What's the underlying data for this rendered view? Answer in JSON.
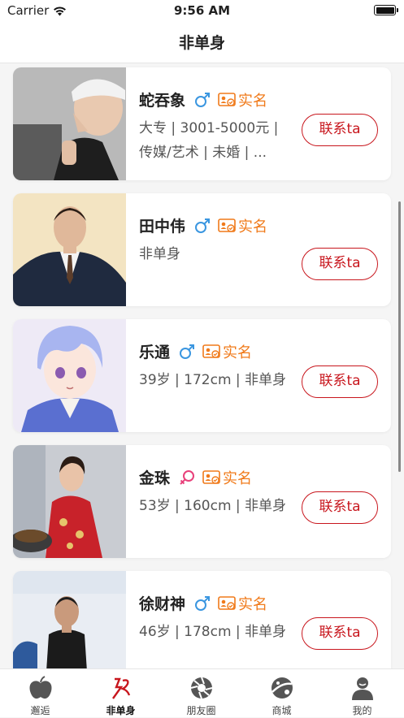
{
  "status": {
    "carrier": "Carrier",
    "time": "9:56 AM"
  },
  "nav": {
    "title": "非单身"
  },
  "colors": {
    "accent": "#c8161d",
    "verified": "#f07a1a",
    "male": "#3a96e0",
    "female": "#e8407a"
  },
  "cards": [
    {
      "name": "蛇吞象",
      "gender": "male-icon",
      "verified": "实名",
      "info": "大专 | 3001-5000元 | 传媒/艺术 | 未婚 | ...",
      "button": "联系ta"
    },
    {
      "name": "田中伟",
      "gender": "male-icon",
      "verified": "实名",
      "info": "非单身",
      "button": "联系ta"
    },
    {
      "name": "乐通",
      "gender": "male-icon",
      "verified": "实名",
      "info": "39岁 | 172cm | 非单身",
      "button": "联系ta"
    },
    {
      "name": "金珠",
      "gender": "female-icon",
      "verified": "实名",
      "info": "53岁 | 160cm | 非单身",
      "button": "联系ta"
    },
    {
      "name": "徐财神",
      "gender": "male-icon",
      "verified": "实名",
      "info": "46岁 | 178cm | 非单身",
      "button": "联系ta"
    }
  ],
  "tabs": [
    {
      "label": "邂逅",
      "icon": "apple-icon"
    },
    {
      "label": "非单身",
      "icon": "non-single-icon",
      "active": true
    },
    {
      "label": "朋友圈",
      "icon": "aperture-icon"
    },
    {
      "label": "商城",
      "icon": "planet-icon"
    },
    {
      "label": "我的",
      "icon": "person-icon"
    }
  ]
}
